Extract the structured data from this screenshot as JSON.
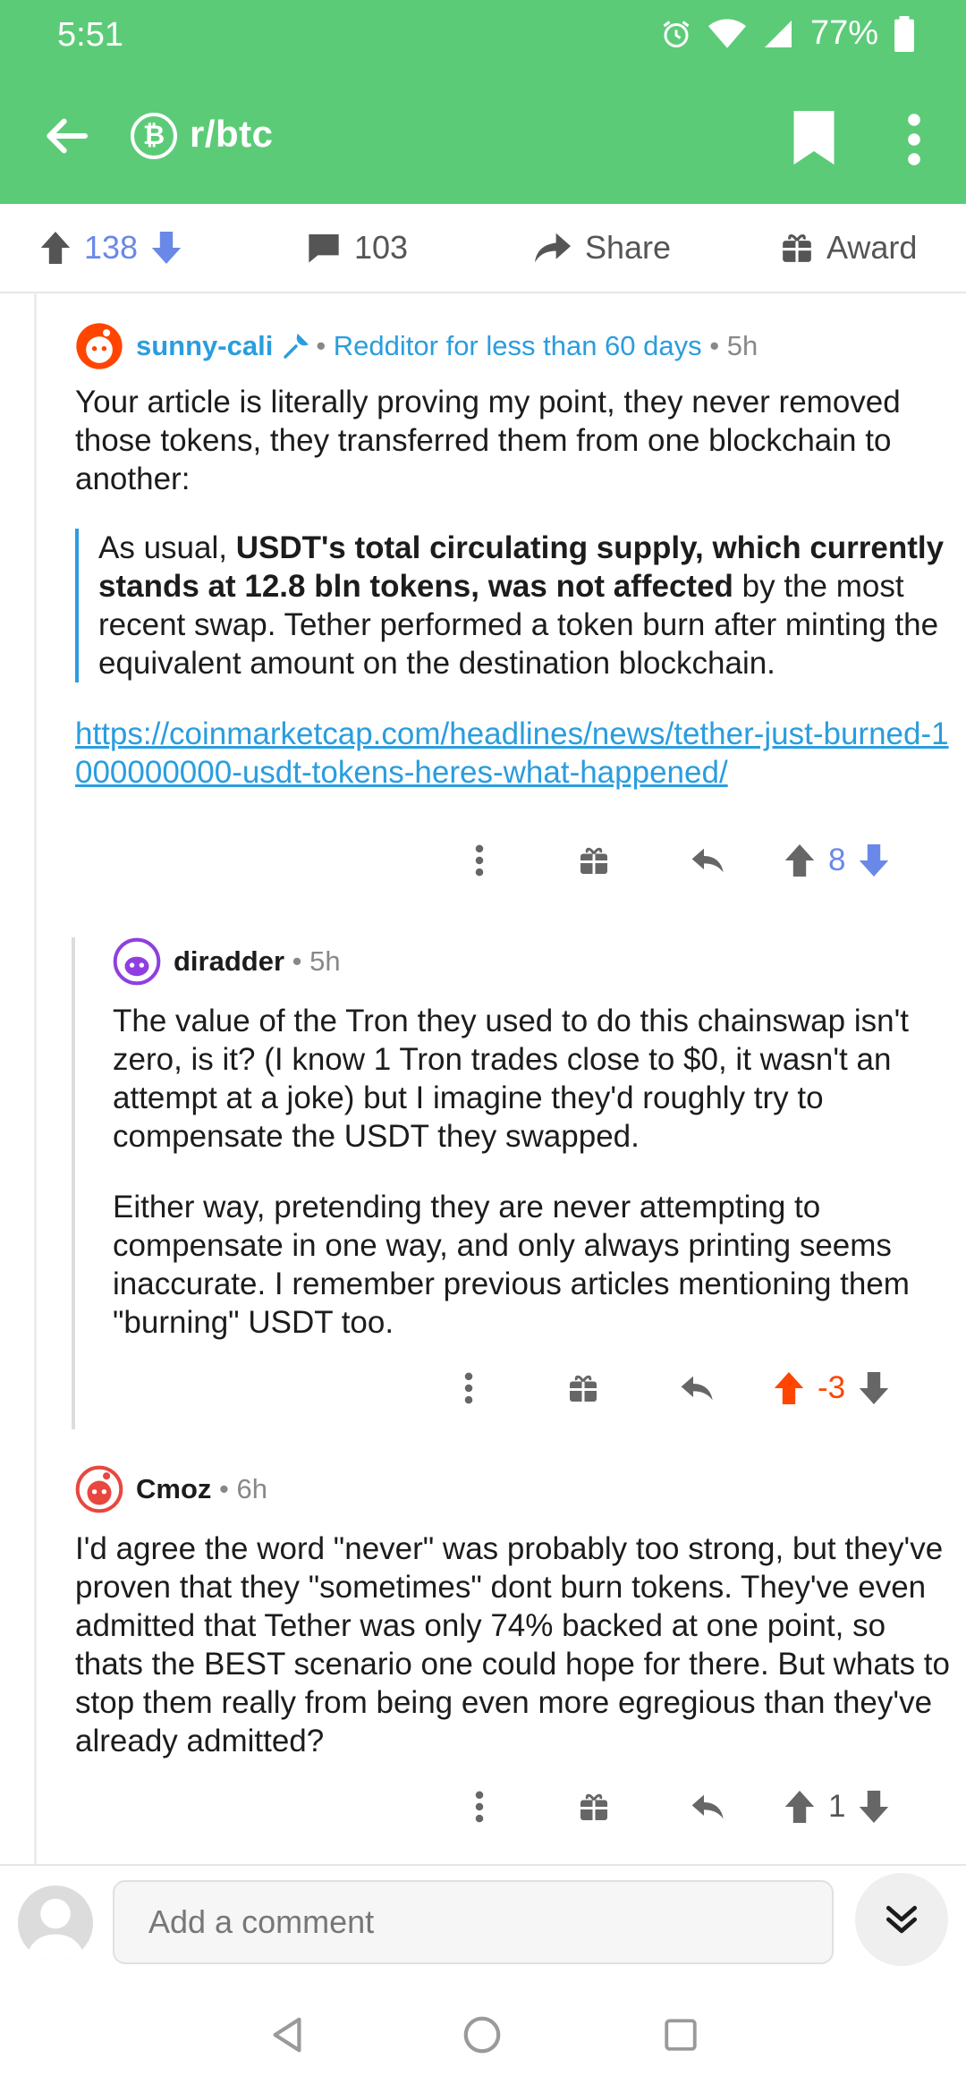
{
  "status_bar": {
    "time": "5:51",
    "battery": "77%"
  },
  "header": {
    "subreddit": "r/btc",
    "subreddit_initial": "₿"
  },
  "actions": {
    "score": "138",
    "comments": "103",
    "share": "Share",
    "award": "Award"
  },
  "comments": [
    {
      "user": "sunny-cali",
      "flair": "Redditor for less than 60 days",
      "age": "5h",
      "paragraph": "Your article is literally proving my point, they never removed those tokens, they transferred them from one blockchain to another:",
      "quote_pre": "As usual, ",
      "quote_bold": "USDT's total circulating supply, which currently stands at 12.8 bln tokens, was not affected",
      "quote_post": " by the most recent swap. Tether performed a token burn after minting the equivalent amount on the destination blockchain.",
      "link": "https://coinmarketcap.com/headlines/news/tether-just-burned-1000000000-usdt-tokens-heres-what-happened/",
      "score": "8",
      "vote_state": "neutral"
    },
    {
      "user": "diradder",
      "age": "5h",
      "paragraph_1": "The value of the Tron they used to do this chainswap isn't zero, is it? (I know 1 Tron trades close to $0, it wasn't an attempt at a joke) but I imagine they'd roughly try to compensate the USDT they swapped.",
      "paragraph_2": "Either way, pretending they are never attempting to compensate in one way, and only always printing seems inaccurate. I remember previous articles mentioning them \"burning\" USDT too.",
      "score": "-3",
      "vote_state": "upvoted"
    },
    {
      "user": "Cmoz",
      "age": "6h",
      "paragraph": "I'd agree the word \"never\" was probably too strong, but they've proven that they \"sometimes\" dont burn tokens. They've even admitted that Tether was only 74% backed at one point, so thats the BEST scenario one could hope for there. But whats to stop them really from being even more egregious than they've already admitted?",
      "score": "1",
      "vote_state": "neutral"
    }
  ],
  "composer": {
    "placeholder": "Add a comment"
  },
  "colors": {
    "header_green": "#5ccb78",
    "upvote_orange": "#ff4500",
    "downvote_blue": "#6a88e8",
    "link_blue": "#2a9dde"
  }
}
